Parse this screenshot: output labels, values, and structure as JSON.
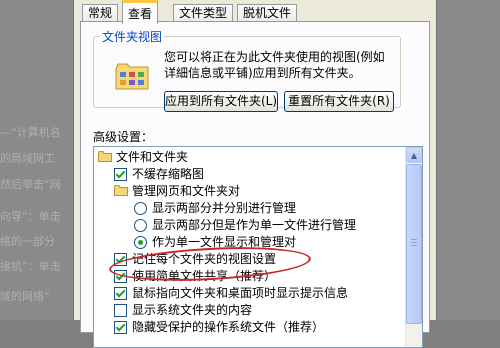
{
  "background_text": {
    "left_lines": [
      "—“计算机名",
      "的局域网工",
      "然后单击“网",
      "向导”：单击",
      "络的一部分",
      "接机”：单击",
      "域的网络”"
    ],
    "right_lines": [
      "",
      "",
      "",
      "",
      "",
      "",
      ""
    ]
  },
  "dialog": {
    "tabs": [
      {
        "label": "常规",
        "active": false
      },
      {
        "label": "查看",
        "active": true
      },
      {
        "label": "文件类型",
        "active": false
      },
      {
        "label": "脱机文件",
        "active": false
      }
    ],
    "folder_views": {
      "legend": "文件夹视图",
      "description": "您可以将正在为此文件夹使用的视图(例如详細信息或平铺)应用到所有文件夹。",
      "apply_button": "应用到所有文件夹(L)",
      "reset_button": "重置所有文件夹(R)"
    },
    "advanced_label": "高级设置：",
    "advanced_items": [
      {
        "type": "folder",
        "label": "文件和文件夹",
        "indent": 0
      },
      {
        "type": "checkbox",
        "label": "不缓存缩略图",
        "checked": true,
        "indent": 1
      },
      {
        "type": "folder",
        "label": "管理网页和文件夹对",
        "indent": 1
      },
      {
        "type": "radio",
        "label": "显示两部分并分别进行管理",
        "checked": false,
        "indent": 2
      },
      {
        "type": "radio",
        "label": "显示两部分但是作为单一文件进行管理",
        "checked": false,
        "indent": 2
      },
      {
        "type": "radio",
        "label": "作为单一文件显示和管理对",
        "checked": true,
        "indent": 2
      },
      {
        "type": "checkbox",
        "label": "记住每个文件夹的视图设置",
        "checked": true,
        "indent": 1
      },
      {
        "type": "checkbox",
        "label": "使用简单文件共享（推荐）",
        "checked": true,
        "indent": 1
      },
      {
        "type": "checkbox",
        "label": "鼠标指向文件夹和桌面项时显示提示信息",
        "checked": true,
        "indent": 1
      },
      {
        "type": "checkbox",
        "label": "显示系统文件夹的内容",
        "checked": false,
        "indent": 1
      },
      {
        "type": "checkbox",
        "label": "隐藏受保护的操作系统文件（推荐）",
        "checked": true,
        "indent": 1
      }
    ]
  },
  "colors": {
    "accent": "#0046d5",
    "annotation": "#c42a2a",
    "check": "#21a121"
  }
}
